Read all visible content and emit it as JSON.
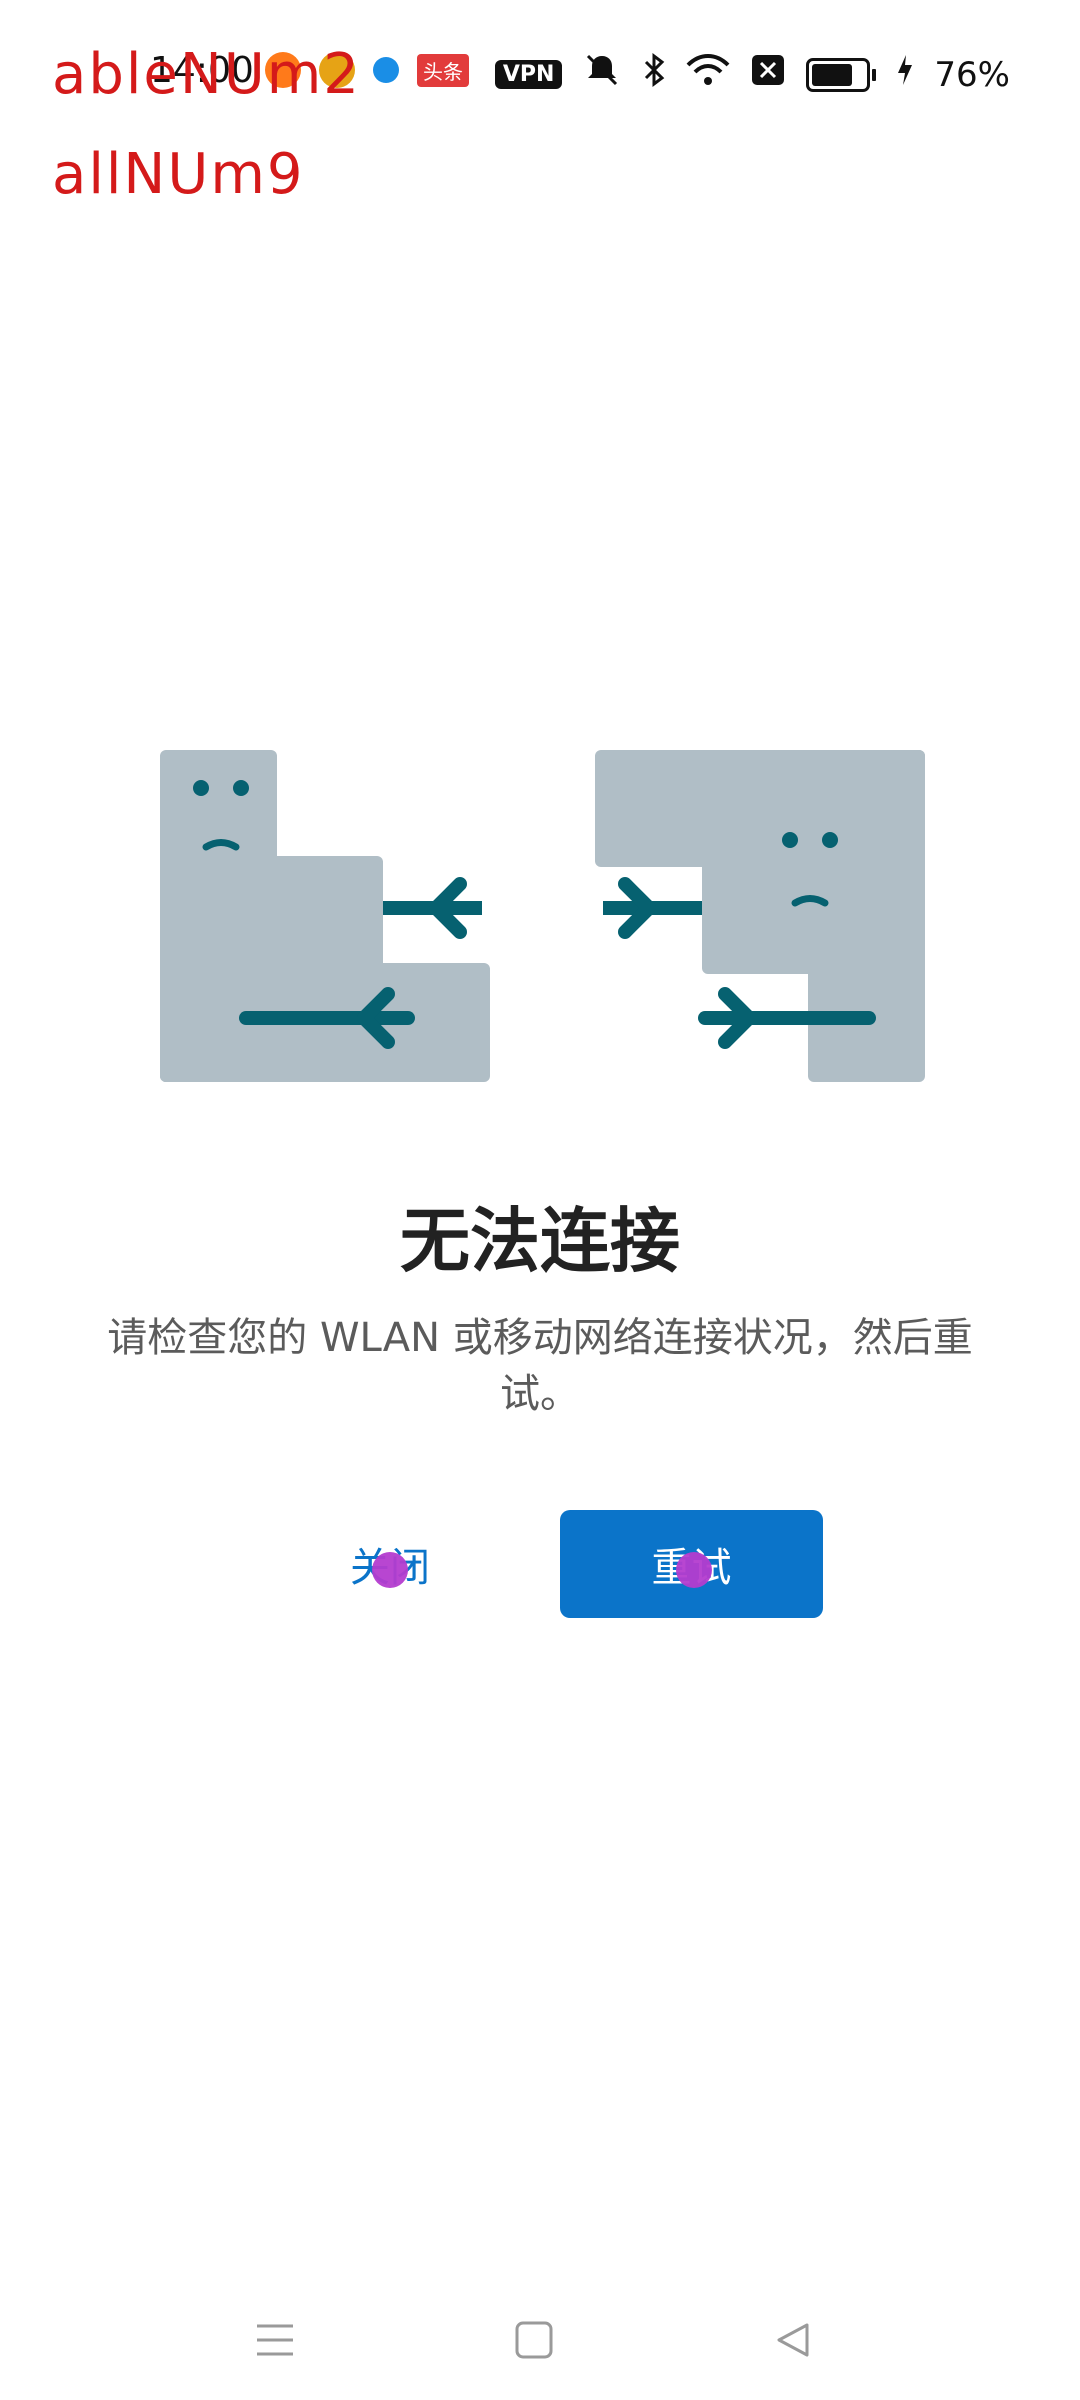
{
  "status_bar": {
    "time": "14:00",
    "badge_toutiao": "头条",
    "vpn": "VPN",
    "battery_percent_text": "76%",
    "battery_level": 0.76
  },
  "overlay_labels": {
    "line1": "ableNUm2",
    "line2": "allNUm9"
  },
  "error": {
    "title": "无法连接",
    "message": "请检查您的 WLAN 或移动网络连接状况，然后重试。"
  },
  "actions": {
    "close_label": "关闭",
    "retry_label": "重试"
  },
  "colors": {
    "accent": "#0b74c9",
    "illustration_block": "#b0bec6",
    "illustration_arrow": "#066170",
    "debug_text": "#d41a1a",
    "touch_dot": "#b43ccf"
  },
  "icons": {
    "nav_menu": "menu-icon",
    "nav_home": "home-icon",
    "nav_back": "back-icon"
  }
}
